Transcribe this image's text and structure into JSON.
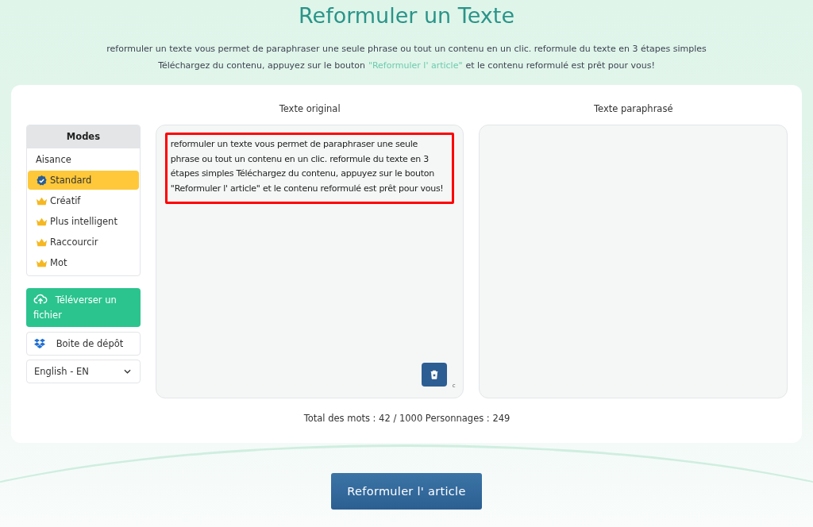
{
  "title": "Reformuler un Texte",
  "intro": {
    "line_1": "reformuler un texte vous permet de paraphraser une seule phrase ou tout un contenu en un clic. reformule du texte en 3 étapes simples",
    "line_2_before": "Téléchargez du contenu, appuyez sur le bouton",
    "line_2_link": "\"Reformuler l' article\"",
    "line_2_after": "et le contenu reformulé est prêt pour vous!"
  },
  "modes": {
    "header": "Modes",
    "items": [
      {
        "label": "Aisance",
        "selected": false,
        "premium": false
      },
      {
        "label": "Standard",
        "selected": true,
        "premium": false
      },
      {
        "label": "Créatif",
        "selected": false,
        "premium": true
      },
      {
        "label": "Plus intelligent",
        "selected": false,
        "premium": true
      },
      {
        "label": "Raccourcir",
        "selected": false,
        "premium": true
      },
      {
        "label": "Mot",
        "selected": false,
        "premium": true
      }
    ]
  },
  "upload_button": {
    "label": "Téléverser un fichier"
  },
  "dropbox_button": {
    "label": "Boite de dépôt"
  },
  "language_select": {
    "value": "English - EN"
  },
  "original": {
    "label": "Texte original",
    "value": "reformuler un texte vous permet de paraphraser une seule phrase ou tout un contenu en un clic. reformule du texte en 3 étapes simples Téléchargez du contenu, appuyez sur le bouton \"Reformuler l' article\" et le contenu reformulé est prêt pour vous!",
    "highlighted": true,
    "corner_mark": "c"
  },
  "paraphrased": {
    "label": "Texte paraphrasé"
  },
  "counts": "Total des mots : 42 / 1000 Personnages : 249",
  "submit_button": {
    "label": "Reformuler l' article"
  }
}
